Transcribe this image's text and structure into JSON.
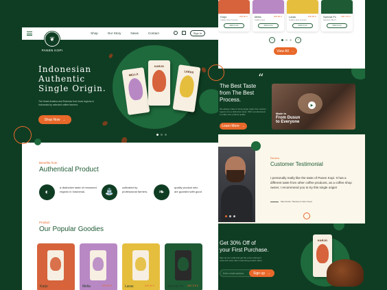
{
  "brand": {
    "name": "PANEN KOPI"
  },
  "nav": {
    "items": [
      "Shop",
      "Our Story",
      "News",
      "Contact"
    ],
    "signin": "Sign In"
  },
  "hero": {
    "title_line1": "Indonesian",
    "title_line2": "Authentic",
    "title_line3": "Single Origin.",
    "subtitle": "The finest Arabica and Robusta from local regions in Indonesia by selected coffee farmers.",
    "cta": "Shop Now",
    "bags": [
      "MELLA",
      "KARJO",
      "LARAS"
    ]
  },
  "benefits": {
    "eyebrow": "Benefits from",
    "title": "Authentical Product",
    "items": [
      {
        "icon": "coffee-bean-icon",
        "text": "a distinctive taste of renowned regions in Indonesia."
      },
      {
        "icon": "watering-can-icon",
        "text": "cultivated by professional farmers."
      },
      {
        "icon": "leaf-icon",
        "text": "quality product who are guarded with good"
      }
    ]
  },
  "popular": {
    "eyebrow": "Product",
    "title": "Our Popular Goodies",
    "products": [
      {
        "name": "Karjo",
        "price": "IDR 80 K",
        "bg": "#d6633c"
      },
      {
        "name": "Mella",
        "price": "IDR 80 K",
        "bg": "#b888c4"
      },
      {
        "name": "Laras",
        "price": "IDR 80 K",
        "bg": "#e6be3e"
      },
      {
        "name": "Special Px",
        "price": "IDR 175 K",
        "bg": "#1e5a34"
      }
    ]
  },
  "top_products": {
    "items": [
      {
        "name": "Karjo",
        "price": "IDR 80 K",
        "sub": "Arabica Java Sumatra",
        "btn": "Add more",
        "bg": "#d6633c"
      },
      {
        "name": "Mella",
        "price": "IDR 80 K",
        "sub": "Arabica Java",
        "btn": "Add more",
        "bg": "#b888c4"
      },
      {
        "name": "Laras",
        "price": "IDR 80 K",
        "sub": "Arabica Java Sumatra",
        "btn": "Add more",
        "bg": "#e6be3e"
      },
      {
        "name": "Special Px",
        "price": "IDR 175 K",
        "sub": "Signature Blend",
        "btn": "Add more",
        "bg": "#1e5a34"
      }
    ],
    "view_all": "View All"
  },
  "process": {
    "quote": "“",
    "title": "The Best Taste from The Best Process.",
    "text": "We always make to bring single origin from various regions into a distinctive taste. With a professional to make sure product quality.",
    "cta": "Learn More",
    "video_caption_1": "Made to",
    "video_caption_2": "From Dusun",
    "video_caption_3": "to Everyone"
  },
  "testimonial": {
    "eyebrow": "Review",
    "title": "Customer Testimonial",
    "quote": "I personally really like the taste of Panen Kopi. It has a different taste from other coffee products, as a coffee shop owner, I recommend you to try this single origin!",
    "author": "Mas Ruslin / Barista & Cafe Owner"
  },
  "promo": {
    "title_line1": "Get 30% Off of",
    "title_line2": "your First Purchase.",
    "text": "Sign up our email and get the promo discount code and news other interesting product offers.",
    "placeholder": "Enter email address",
    "cta": "Sign up",
    "bag": "KARJO"
  },
  "colors": {
    "green": "#0f3d23",
    "accent": "#e8682a",
    "cream": "#fbf7ea"
  }
}
